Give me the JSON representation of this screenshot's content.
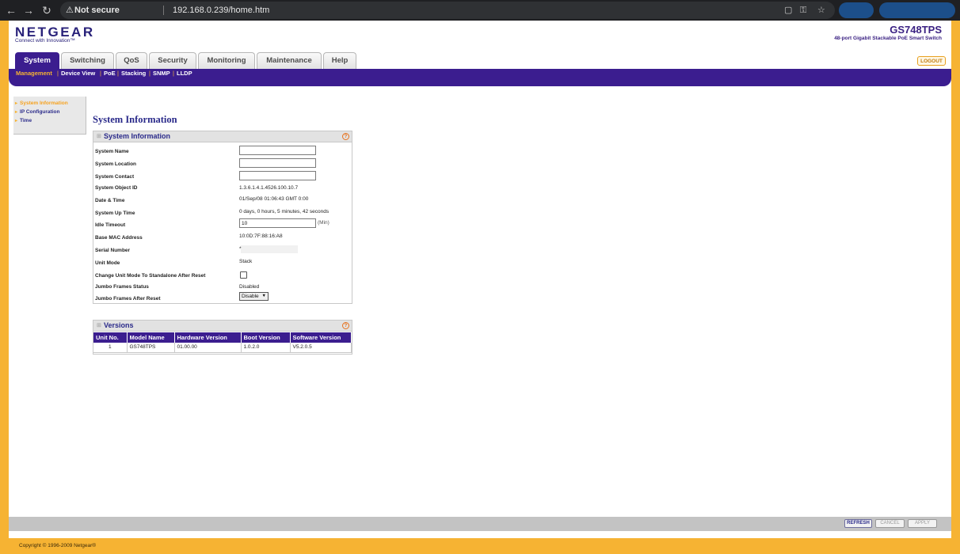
{
  "browser": {
    "security_label": "Not secure",
    "url": "192.168.0.239/home.htm"
  },
  "header": {
    "logo_text": "NETGEAR",
    "logo_tagline": "Connect with Innovation™",
    "model": "GS748TPS",
    "model_description": "48-port Gigabit Stackable PoE Smart Switch",
    "logout_label": "LOGOUT"
  },
  "tabs": [
    {
      "label": "System",
      "active": true
    },
    {
      "label": "Switching",
      "active": false
    },
    {
      "label": "QoS",
      "active": false
    },
    {
      "label": "Security",
      "active": false
    },
    {
      "label": "Monitoring",
      "active": false
    },
    {
      "label": "Maintenance",
      "active": false
    },
    {
      "label": "Help",
      "active": false
    }
  ],
  "subnav": [
    {
      "label": "Management",
      "active": true
    },
    {
      "label": "Device View",
      "active": false
    },
    {
      "label": "PoE",
      "active": false
    },
    {
      "label": "Stacking",
      "active": false
    },
    {
      "label": "SNMP",
      "active": false
    },
    {
      "label": "LLDP",
      "active": false
    }
  ],
  "left_nav": [
    {
      "label": "System Information",
      "active": true
    },
    {
      "label": "IP Configuration",
      "active": false
    },
    {
      "label": "Time",
      "active": false
    }
  ],
  "page_title": "System Information",
  "system_info": {
    "panel_title": "System Information",
    "rows": {
      "system_name": {
        "label": "System Name",
        "value": ""
      },
      "system_location": {
        "label": "System Location",
        "value": ""
      },
      "system_contact": {
        "label": "System Contact",
        "value": ""
      },
      "system_object_id": {
        "label": "System Object ID",
        "value": "1.3.6.1.4.1.4526.100.10.7"
      },
      "date_time": {
        "label": "Date & Time",
        "value": "01/Sep/08 01:06:43 GMT 0:00"
      },
      "system_up_time": {
        "label": "System Up Time",
        "value": "0 days, 0 hours, 5 minutes, 42 seconds"
      },
      "idle_timeout": {
        "label": "Idle Timeout",
        "value": "10",
        "unit": "(Min)"
      },
      "base_mac": {
        "label": "Base MAC Address",
        "value": "10:0D:7F:88:16:A8"
      },
      "serial_number": {
        "label": "Serial Number",
        "value": "*"
      },
      "unit_mode": {
        "label": "Unit Mode",
        "value": "Stack"
      },
      "change_unit_mode": {
        "label": "Change Unit Mode To Standalone After Reset",
        "checked": false
      },
      "jumbo_status": {
        "label": "Jumbo Frames Status",
        "value": "Disabled"
      },
      "jumbo_after_reset": {
        "label": "Jumbo Frames After Reset",
        "value": "Disable"
      }
    }
  },
  "versions": {
    "panel_title": "Versions",
    "columns": [
      "Unit No.",
      "Model Name",
      "Hardware Version",
      "Boot Version",
      "Software Version"
    ],
    "rows": [
      [
        "1",
        "GS748TPS",
        "01.00.00",
        "1.0.2.0",
        "V5.2.0.5"
      ]
    ]
  },
  "buttons": {
    "refresh": "REFRESH",
    "cancel": "CANCEL",
    "apply": "APPLY"
  },
  "footer": {
    "copyright": "Copyright © 1996-2009 Netgear®"
  }
}
